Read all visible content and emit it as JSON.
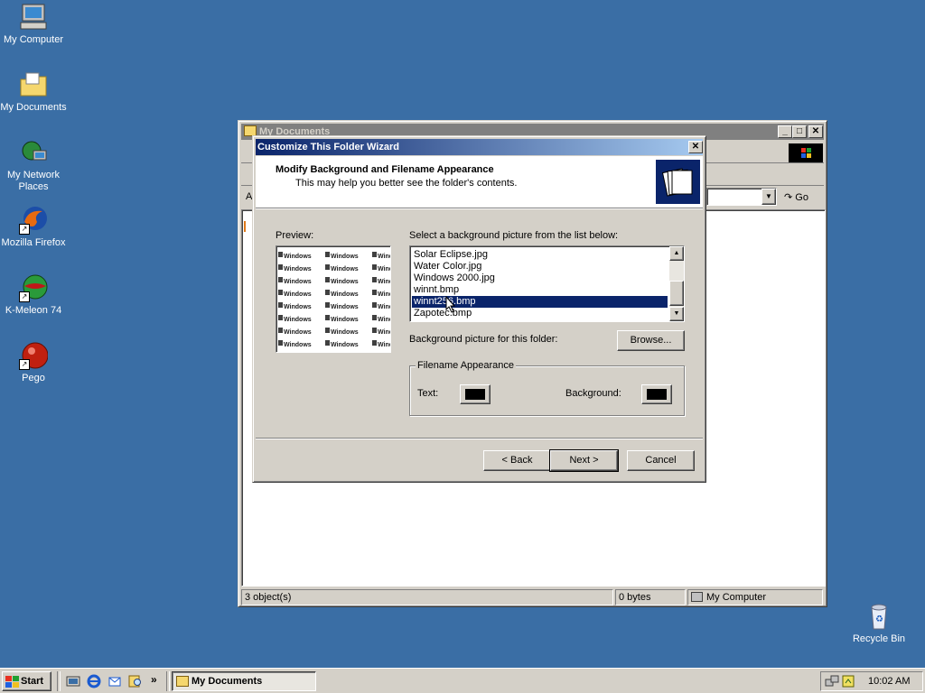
{
  "desktop": {
    "icons": [
      {
        "label": "My Computer"
      },
      {
        "label": "My Documents"
      },
      {
        "label": "My Network Places"
      },
      {
        "label": "Mozilla Firefox"
      },
      {
        "label": "K-Meleon 74"
      },
      {
        "label": "Pego"
      },
      {
        "label": "Recycle Bin"
      }
    ],
    "background_color": "#3a6ea5"
  },
  "explorer": {
    "title": "My Documents",
    "go_label": "Go",
    "address_prefix": "A",
    "status": {
      "objects": "3 object(s)",
      "size": "0 bytes",
      "zone": "My Computer"
    }
  },
  "wizard": {
    "title": "Customize This Folder Wizard",
    "heading": "Modify Background and Filename Appearance",
    "subheading": "This may help you better see the folder's contents.",
    "preview_label": "Preview:",
    "list_label": "Select a background picture from the list below:",
    "list_items": [
      "Solar Eclipse.jpg",
      "Water Color.jpg",
      "Windows 2000.jpg",
      "winnt.bmp",
      "winnt256.bmp",
      "Zapotec.bmp"
    ],
    "selected_item": "winnt256.bmp",
    "bg_picture_label": "Background picture for this folder:",
    "browse_label": "Browse...",
    "filename_group": "Filename Appearance",
    "text_label": "Text:",
    "background_label": "Background:",
    "text_color": "#000000",
    "background_color": "#000000",
    "back_label": "< Back",
    "next_label": "Next >",
    "cancel_label": "Cancel",
    "preview_word": "Windows"
  },
  "taskbar": {
    "start_label": "Start",
    "task_label": "My Documents",
    "chevron": "»",
    "clock": "10:02 AM"
  }
}
